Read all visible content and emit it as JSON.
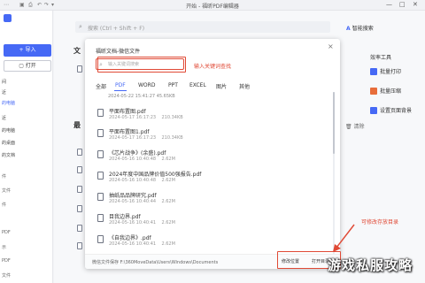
{
  "window": {
    "title": "开始 - 福昕PDF编辑器",
    "controls": [
      "—",
      "□",
      "✕"
    ]
  },
  "sidebar": {
    "import_label": "+ 导入",
    "open_label": "打开",
    "items": [
      "间",
      "近",
      "的电脑",
      "的桌面",
      "的文档",
      "件",
      "文件",
      "件",
      "",
      "PDF",
      "示",
      "PDF",
      "文件"
    ]
  },
  "main": {
    "search_placeholder": "搜索 (Ctrl + Shift + F)",
    "ai_search_label": "智能搜索",
    "section_doc": "文",
    "section_recent": "最"
  },
  "right_tools": {
    "heading": "效率工具",
    "items": [
      {
        "label": "批量打印",
        "color": "#4669f5"
      },
      {
        "label": "批量压缩",
        "color": "#e86d3a"
      },
      {
        "label": "设置页面背景",
        "color": "#4669f5"
      }
    ],
    "clear_label": "清除"
  },
  "dialog": {
    "title": "福昕文档-微信文件",
    "search_placeholder": "输入关键词搜索",
    "tabs": [
      "全部",
      "PDF",
      "WORD",
      "PPT",
      "EXCEL",
      "图片",
      "其他"
    ],
    "active_tab": "PDF",
    "partial_row_meta": "2024-05-22  15:41:27       45.65KB",
    "files": [
      {
        "name": "平面布置图.pdf",
        "date": "2024-05-17 16:17:23",
        "size": "210.34KB"
      },
      {
        "name": "平面布置图1.pdf",
        "date": "2024-05-17 16:17:23",
        "size": "210.34KB"
      },
      {
        "name": "《芯片战争》(余盛).pdf",
        "date": "2024-05-16 10:40:48",
        "size": "2.62M"
      },
      {
        "name": "2024年度中国品牌价值500强报告.pdf",
        "date": "2024-05-16 10:40:48",
        "size": "2.62M"
      },
      {
        "name": "抽纸品品牌研究.pdf",
        "date": "2024-05-16 10:40:44",
        "size": "2.62M"
      },
      {
        "name": "目我边界.pdf",
        "date": "2024-05-16 10:40:41",
        "size": "2.62M"
      },
      {
        "name": "《自我边界》.pdf",
        "date": "2024-05-16 10:40:41",
        "size": "2.62M"
      }
    ],
    "footer_path": "微信文件保存 F:\\360MoveData\\Users\\Windows\\Documents",
    "modify_location_label": "修改位置",
    "open_dir_label": "打开目录"
  },
  "annotations": {
    "search_hint": "输入关键词查找",
    "dir_hint": "可修改存放目录"
  },
  "watermark": "游戏私服攻略"
}
